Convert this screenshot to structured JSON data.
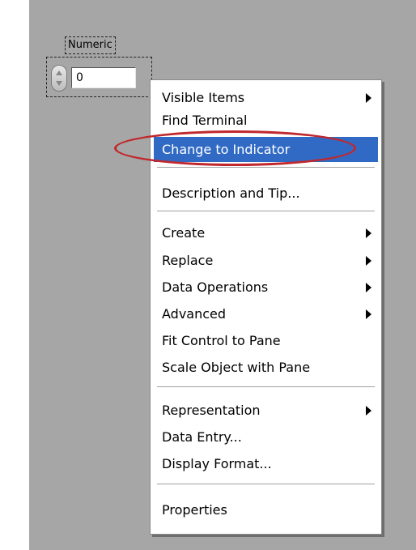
{
  "control": {
    "label": "Numeric",
    "value": "0"
  },
  "menu": {
    "items": [
      {
        "label": "Visible Items",
        "submenu": true
      },
      {
        "label": "Find Terminal",
        "submenu": false
      },
      {
        "label": "Change to Indicator",
        "submenu": false,
        "highlighted": true
      },
      {
        "label": "Description and Tip...",
        "submenu": false
      },
      {
        "label": "Create",
        "submenu": true
      },
      {
        "label": "Replace",
        "submenu": true
      },
      {
        "label": "Data Operations",
        "submenu": true
      },
      {
        "label": "Advanced",
        "submenu": true
      },
      {
        "label": "Fit Control to Pane",
        "submenu": false
      },
      {
        "label": "Scale Object with Pane",
        "submenu": false
      },
      {
        "label": "Representation",
        "submenu": true
      },
      {
        "label": "Data Entry...",
        "submenu": false
      },
      {
        "label": "Display Format...",
        "submenu": false
      },
      {
        "label": "Properties",
        "submenu": false
      }
    ]
  },
  "colors": {
    "panel_background": "#a6a6a6",
    "menu_highlight": "#316ac5",
    "annotation_ellipse": "#c0282d"
  }
}
